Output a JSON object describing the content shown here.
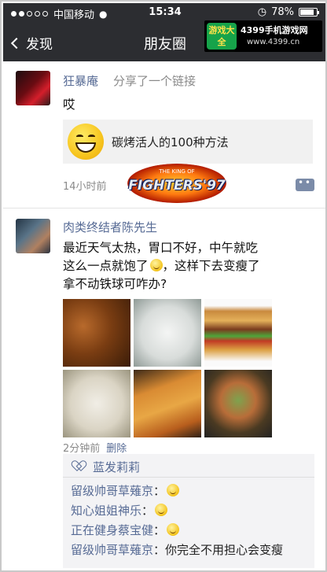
{
  "status_bar": {
    "carrier": "中国移动",
    "time": "15:34",
    "battery": "78%",
    "battery_level": 0.78,
    "signal_bars": 2
  },
  "nav": {
    "back_label": "发现",
    "title": "朋友圈"
  },
  "watermark": {
    "badge": "游戏大全",
    "name": "4399手机游戏网",
    "url": "www.4399.cn"
  },
  "posts": [
    {
      "author": "狂暴庵",
      "action": "分享了一个链接",
      "text": "哎",
      "link_title": "碳烤活人的100种方法",
      "time": "14小时前",
      "overlay_logo": {
        "main": "FIGHTERS'97",
        "small": "THE KING OF"
      }
    },
    {
      "author": "肉类终结者陈先生",
      "text_lines": [
        "最近天气太热，胃口不好，中午就吃",
        "这么一点就饱了",
        "，这样下去变瘦了",
        "拿不动铁球可咋办?"
      ],
      "time": "2分钟前",
      "delete_label": "删除",
      "photos": [
        "braised-meat",
        "steamed-buns",
        "hamburger",
        "dumplings",
        "pizza",
        "banquet-dishes"
      ],
      "likes": [
        "蓝发莉莉"
      ],
      "comments": [
        {
          "name": "留级帅哥草薙京",
          "sep": "：",
          "text": ""
        },
        {
          "name": "知心姐姐神乐",
          "sep": "：",
          "text": ""
        },
        {
          "name": "正在健身蔡宝健",
          "sep": "：",
          "text": ""
        },
        {
          "name": "留级帅哥草薙京",
          "sep": "：",
          "text": "你完全不用担心会变瘦"
        }
      ]
    }
  ],
  "colors": {
    "header_bg": "#2c2d31",
    "name_link": "#576b95",
    "meta_gray": "#8a8a8a",
    "panel_bg": "#f3f3f5"
  }
}
